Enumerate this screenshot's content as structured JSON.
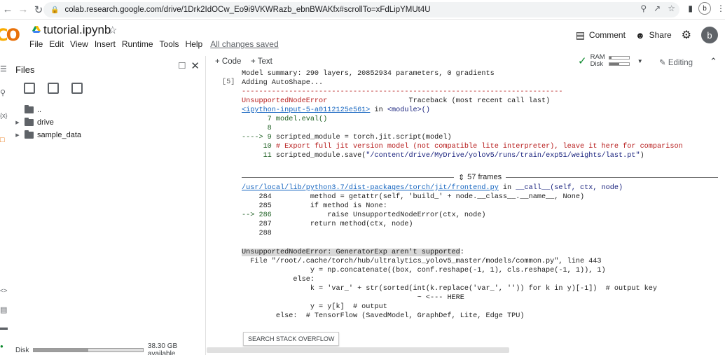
{
  "browser": {
    "url": "colab.research.google.com/drive/1Drk2IdOCw_Eo9i9VKWRazb_ebnBWAKfx#scrollTo=xFdLipYMUt4U",
    "profile_initial": "b"
  },
  "header": {
    "logo": "CO",
    "notebook_title": "tutorial.ipynb",
    "menu": [
      "File",
      "Edit",
      "View",
      "Insert",
      "Runtime",
      "Tools",
      "Help"
    ],
    "saved_status": "All changes saved",
    "comment_label": "Comment",
    "share_label": "Share",
    "avatar_initial": "b"
  },
  "files_panel": {
    "title": "Files",
    "tree": [
      {
        "label": "..",
        "expandable": false
      },
      {
        "label": "drive",
        "expandable": true
      },
      {
        "label": "sample_data",
        "expandable": true
      }
    ],
    "disk_label": "Disk",
    "disk_available": "38.30 GB available",
    "disk_used_fraction": 0.5
  },
  "rail": {
    "icons": [
      "menu-icon",
      "search-icon",
      "code-snippets-icon",
      "folder-icon",
      "variables-icon",
      "terminal-icon",
      "console-icon"
    ]
  },
  "toolbar": {
    "add_code": "+ Code",
    "add_text": "+ Text",
    "ram_label": "RAM",
    "disk_label": "Disk",
    "ram_fraction": 0.1,
    "disk_fraction": 0.5,
    "editing_label": "Editing"
  },
  "output": {
    "exec_count": "[5]",
    "summary": "Model summary: 290 layers, 20852934 parameters, 0 gradients",
    "autoshape": "Adding AutoShape...",
    "dashes": "---------------------------------------------------------------------------",
    "error_name": "UnsupportedNodeError",
    "traceback_label": "Traceback (most recent call last)",
    "ipy_link": "<ipython-input-5-a0112125e561>",
    "in_word": " in ",
    "module": "<module>()",
    "l7": "      7 model.eval()",
    "l8": "      8",
    "arrow9_prefix": "----> 9 ",
    "l9_code": "scripted_module = torch.jit.script(model)",
    "l10_num": "     10 ",
    "l10_comment": "# Export full jit version model (not compatible lite interpreter), leave it here for comparison",
    "l11_num": "     11 ",
    "l11_code": "scripted_module.save(",
    "l11_str": "\"/content/drive/MyDrive/yolov5/runs/train/exp51/weights/last.pt\"",
    "l11_end": ")",
    "frames_label": "57 frames",
    "frontend_link": "/usr/local/lib/python3.7/dist-packages/torch/jit/frontend.py",
    "frontend_in": " in ",
    "frontend_call": "__call__(self, ctx, node)",
    "f284": "    284         method = getattr(self, 'build_' + node.__class__.__name__, None)",
    "f285": "    285         if method is None:",
    "f286_prefix": "--> 286 ",
    "f286_code": "            raise UnsupportedNodeError(ctx, node)",
    "f287": "    287         return method(ctx, node)",
    "f288": "    288",
    "final_error": "UnsupportedNodeError: GeneratorExp aren't supported",
    "final_colon": ":",
    "t1": "  File \"/root/.cache/torch/hub/ultralytics_yolov5_master/models/common.py\", line 443",
    "t2": "                y = np.concatenate((box, conf.reshape(-1, 1), cls.reshape(-1, 1)), 1)",
    "t3": "            else:",
    "t4": "                k = 'var_' + str(sorted(int(k.replace('var_', '')) for k in y)[-1])  # output key",
    "t5": "                                         ~ <--- HERE",
    "t6": "                y = y[k]  # output",
    "t7": "        else:  # TensorFlow (SavedModel, GraphDef, Lite, Edge TPU)",
    "so_button": "SEARCH STACK OVERFLOW"
  }
}
